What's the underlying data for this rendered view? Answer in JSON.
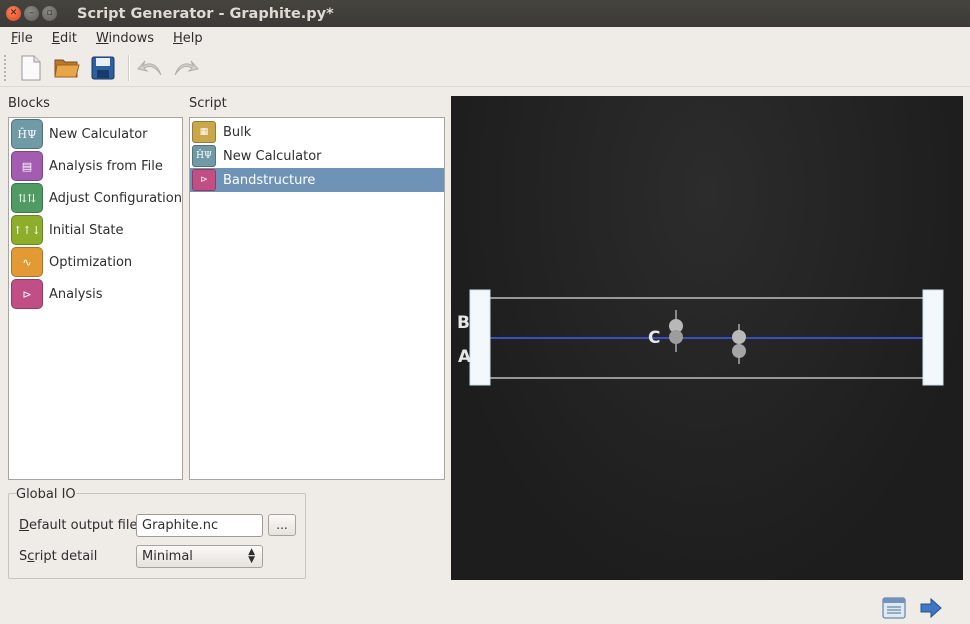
{
  "window": {
    "title": "Script Generator - Graphite.py*"
  },
  "menu": [
    {
      "label": "File",
      "mnemonic": "F",
      "rest": "ile"
    },
    {
      "label": "Edit",
      "mnemonic": "E",
      "rest": "dit"
    },
    {
      "label": "Windows",
      "mnemonic": "W",
      "rest": "indows"
    },
    {
      "label": "Help",
      "mnemonic": "H",
      "rest": "elp"
    }
  ],
  "toolbar": {
    "icons": [
      "new-file-icon",
      "open-folder-icon",
      "save-icon",
      "undo-icon",
      "redo-icon"
    ]
  },
  "blocks": {
    "header": "Blocks",
    "items": [
      {
        "label": "New Calculator",
        "icon": "calculator-icon",
        "color": "#6f9aa6"
      },
      {
        "label": "Analysis from File",
        "icon": "analysis-file-icon",
        "color": "#a35cb0"
      },
      {
        "label": "Adjust Configuration",
        "icon": "adjust-config-icon",
        "color": "#4f9b63"
      },
      {
        "label": "Initial State",
        "icon": "initial-state-icon",
        "color": "#8cae2a"
      },
      {
        "label": "Optimization",
        "icon": "optimization-icon",
        "color": "#e39a34"
      },
      {
        "label": "Analysis",
        "icon": "analysis-icon",
        "color": "#c14f86"
      }
    ]
  },
  "script": {
    "header": "Script",
    "items": [
      {
        "label": "Bulk",
        "icon": "bulk-icon",
        "color": "#c9a74a"
      },
      {
        "label": "New Calculator",
        "icon": "calculator-icon",
        "color": "#6f9aa6"
      },
      {
        "label": "Bandstructure",
        "icon": "bandstructure-icon",
        "color": "#c14f86",
        "selected": true
      }
    ]
  },
  "global_io": {
    "title": "Global IO",
    "output_label": "Default output file",
    "output_mnemonic": "D",
    "output_rest": "efault output file",
    "output_value": "Graphite.nc",
    "browse_label": "...",
    "detail_label": "Script detail",
    "detail_pre": "S",
    "detail_mnemonic": "c",
    "detail_rest": "ript detail",
    "detail_value": "Minimal"
  },
  "viewer": {
    "axis_labels": {
      "a": "A",
      "b": "B",
      "c": "C"
    },
    "colors": {
      "background": "#1e1e1e",
      "cell": "#bdbdbd",
      "axis": "#3a4ec4"
    }
  }
}
